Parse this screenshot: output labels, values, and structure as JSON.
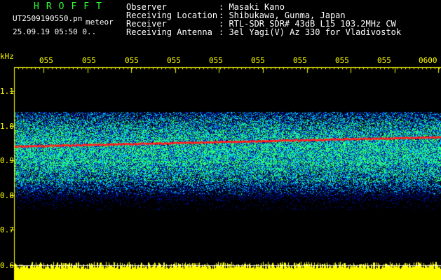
{
  "header": {
    "brand": "HROFFT",
    "filename": "UT2509190550.pn",
    "tagline": "meteor",
    "timestamp": "25.09.19 05:50   0..",
    "fields": [
      {
        "label": "Observer",
        "value": ": Masaki Kano"
      },
      {
        "label": "Receiving Location",
        "value": ": Shibukawa, Gunma, Japan"
      },
      {
        "label": "Receiver",
        "value": ": RTL-SDR SDR# 43dB L15 103.2MHz CW"
      },
      {
        "label": "Receiving Antenna",
        "value": ": 3el Yagi(V) Az 330 for Vladivostok"
      }
    ]
  },
  "spectrogram": {
    "unit": "kHz",
    "time_ticks": [
      "055",
      "055",
      "055",
      "055",
      "055",
      "055",
      "055",
      "055",
      "055",
      "0600"
    ],
    "freq_ticks": [
      "1.1",
      "1.0",
      "0.9",
      "0.8",
      "0.7",
      "0.6"
    ],
    "colors": {
      "axis": "#ffff00",
      "signal": "#ff2020",
      "noise_low": "#0010a0",
      "noise_mid": "#00c8ff",
      "noise_high": "#30ff60",
      "amplitude": "#ffff00"
    }
  }
}
